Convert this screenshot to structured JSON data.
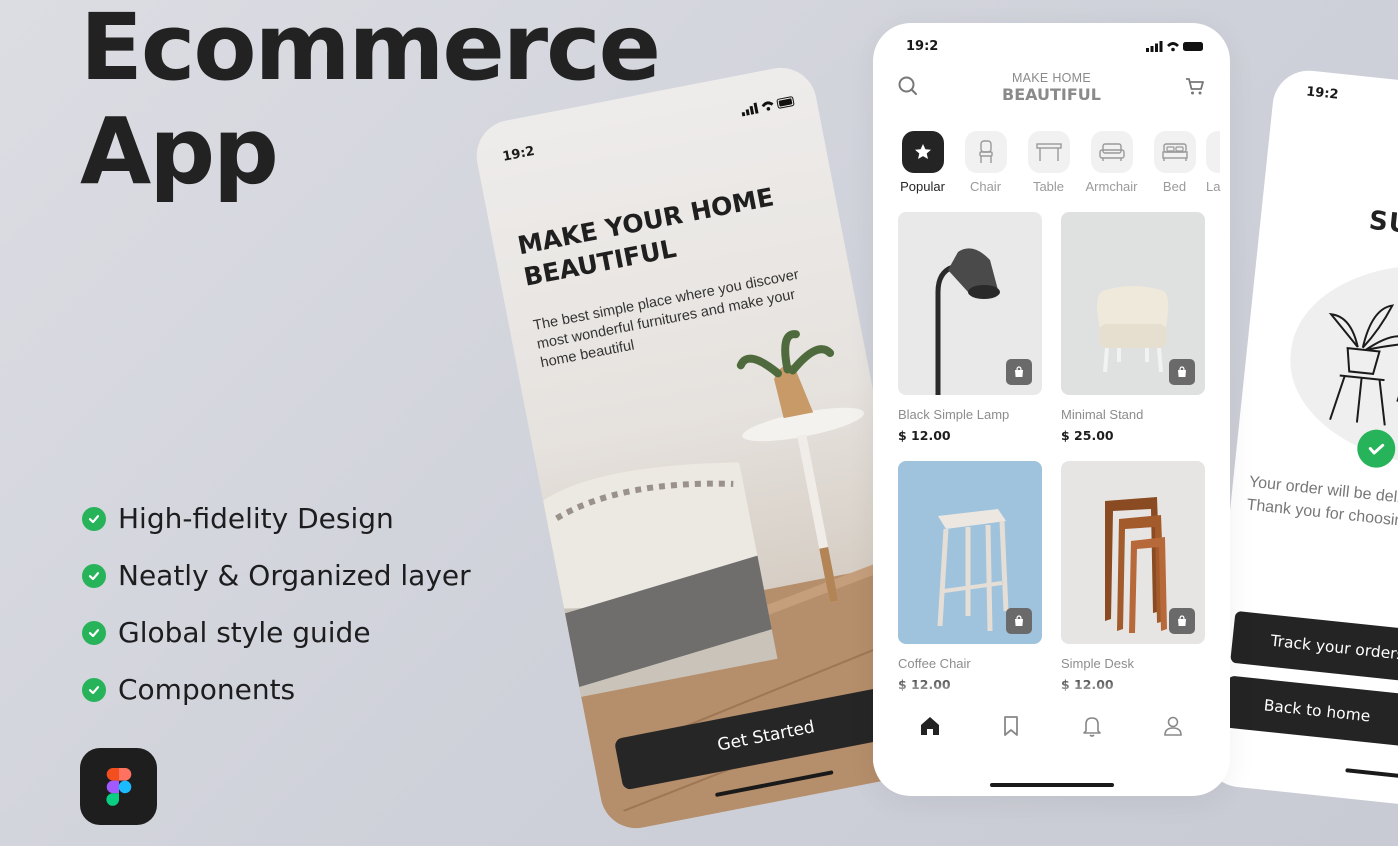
{
  "hero": {
    "line1": "Ecommerce",
    "line2": "App"
  },
  "features": [
    {
      "label": "High-fidelity Design",
      "icon": "check-icon"
    },
    {
      "label": "Neatly & Organized layer",
      "icon": "check-icon"
    },
    {
      "label": "Global style guide",
      "icon": "check-icon"
    },
    {
      "label": "Components",
      "icon": "check-icon"
    }
  ],
  "figma_logo": "figma-icon",
  "onboarding": {
    "status_time": "19:2",
    "title": "MAKE YOUR HOME BEAUTIFUL",
    "subtitle": "The best simple place where you discover most wonderful furnitures and make your home beautiful",
    "cta": "Get Started"
  },
  "catalog": {
    "status_time": "19:2",
    "header_small": "MAKE HOME",
    "header_big": "BEAUTIFUL",
    "categories": [
      {
        "label": "Popular",
        "icon": "star-icon",
        "active": true
      },
      {
        "label": "Chair",
        "icon": "chair-icon",
        "active": false
      },
      {
        "label": "Table",
        "icon": "table-icon",
        "active": false
      },
      {
        "label": "Armchair",
        "icon": "armchair-icon",
        "active": false
      },
      {
        "label": "Bed",
        "icon": "bed-icon",
        "active": false
      },
      {
        "label": "La",
        "icon": "lamp-icon",
        "active": false
      }
    ],
    "products": [
      {
        "name": "Black Simple Lamp",
        "price": "$ 12.00",
        "bg": "#e9e9e9"
      },
      {
        "name": "Minimal Stand",
        "price": "$ 25.00",
        "bg": "#dfe1e0"
      },
      {
        "name": "Coffee Chair",
        "price": "$ 12.00",
        "bg": "#9fc3dc"
      },
      {
        "name": "Simple Desk",
        "price": "$ 12.00",
        "bg": "#e6e5e3"
      }
    ],
    "nav": [
      "home-icon",
      "bookmark-icon",
      "bell-icon",
      "profile-icon"
    ]
  },
  "success": {
    "status_time": "19:2",
    "title": "SUC",
    "message_line1": "Your order will be deliv",
    "message_line2": "Thank you for choosin",
    "track_button": "Track your orders",
    "home_button": "Back to home"
  },
  "colors": {
    "accent_green": "#27b35a",
    "dark": "#242424",
    "background": "#d4d5dd"
  }
}
